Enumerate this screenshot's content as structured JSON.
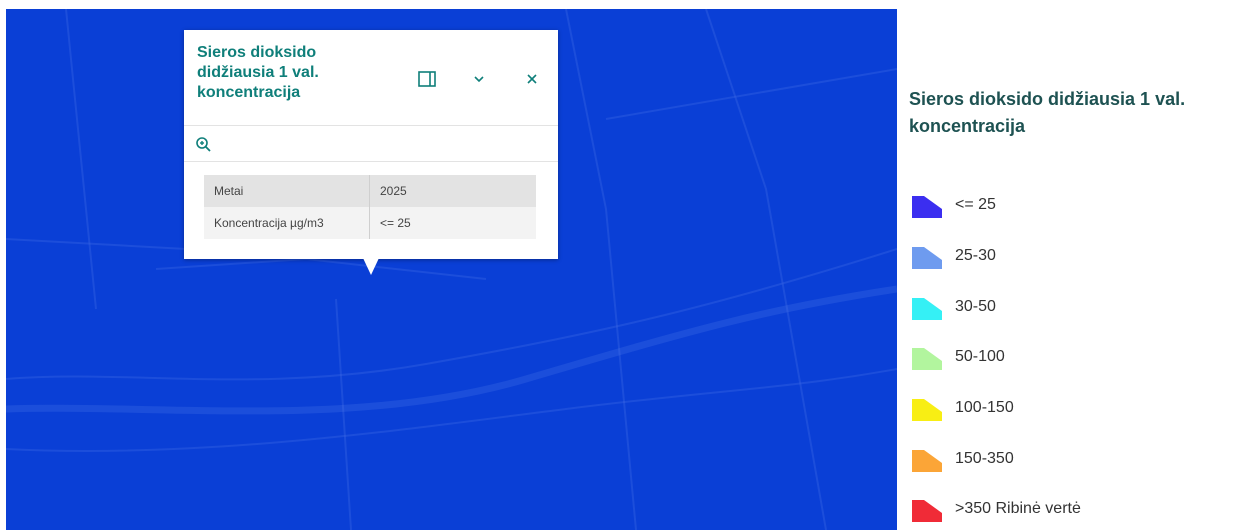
{
  "popup": {
    "title": "Sieros dioksido didžiausia 1 val. koncentracija",
    "icons": {
      "dock": "dock-icon",
      "collapse": "chevron-down-icon",
      "close": "close-icon",
      "zoom": "zoom-in-icon"
    },
    "rows": [
      {
        "key": "Metai",
        "value": "2025"
      },
      {
        "key": "Koncentracija µg/m3",
        "value": "<= 25"
      }
    ]
  },
  "legend": {
    "title": "Sieros dioksido didžiausia 1 val. koncentracija",
    "items": [
      {
        "label": "<= 25",
        "color": "#3b2ef0"
      },
      {
        "label": "25-30",
        "color": "#6e9bef"
      },
      {
        "label": "30-50",
        "color": "#35f0f5"
      },
      {
        "label": "50-100",
        "color": "#b2f59e"
      },
      {
        "label": "100-150",
        "color": "#f8ee14"
      },
      {
        "label": "150-350",
        "color": "#fba537"
      },
      {
        "label": ">350 Ribinė vertė",
        "color": "#f02b37"
      }
    ]
  },
  "colors": {
    "map_fill": "#0a3fd6",
    "accent": "#0f7f7a"
  }
}
